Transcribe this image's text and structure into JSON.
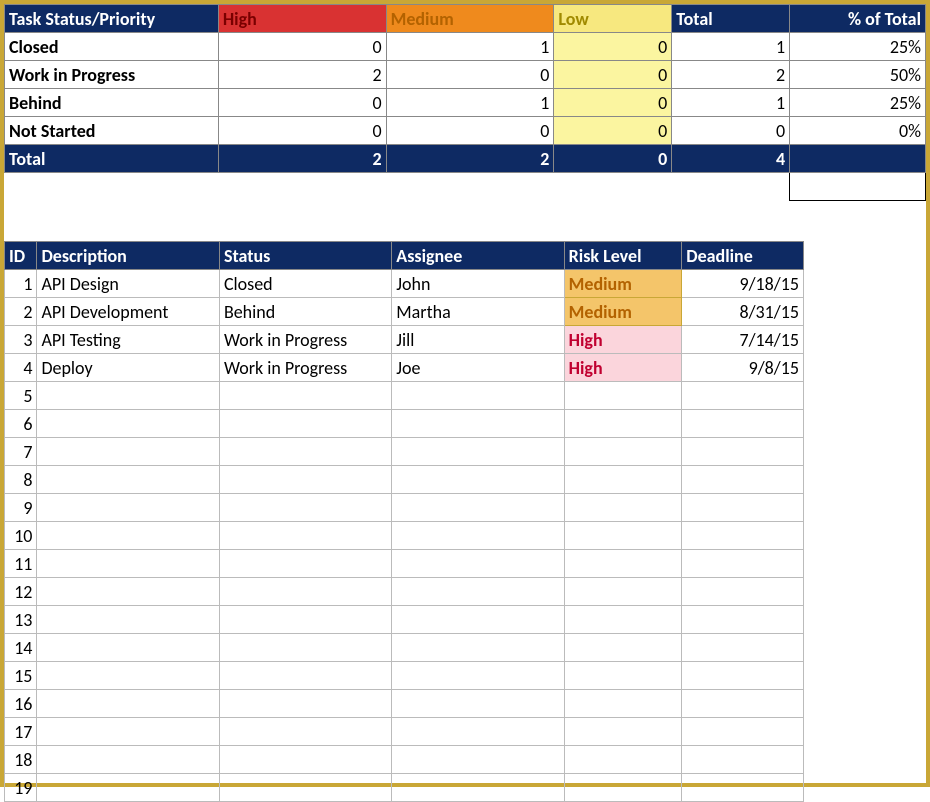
{
  "summary": {
    "header": {
      "status_priority": "Task Status/Priority",
      "high": "High",
      "medium": "Medium",
      "low": "Low",
      "total": "Total",
      "pct": "% of Total"
    },
    "rows": [
      {
        "label": "Closed",
        "high": "0",
        "medium": "1",
        "low": "0",
        "total": "1",
        "pct": "25%"
      },
      {
        "label": "Work in Progress",
        "high": "2",
        "medium": "0",
        "low": "0",
        "total": "2",
        "pct": "50%"
      },
      {
        "label": "Behind",
        "high": "0",
        "medium": "1",
        "low": "0",
        "total": "1",
        "pct": "25%"
      },
      {
        "label": "Not Started",
        "high": "0",
        "medium": "0",
        "low": "0",
        "total": "0",
        "pct": "0%"
      }
    ],
    "totals": {
      "label": "Total",
      "high": "2",
      "medium": "2",
      "low": "0",
      "total": "4",
      "pct": ""
    }
  },
  "tasks": {
    "header": {
      "id": "ID",
      "description": "Description",
      "status": "Status",
      "assignee": "Assignee",
      "risk": "Risk Level",
      "deadline": "Deadline"
    },
    "rows": [
      {
        "id": "1",
        "description": "API Design",
        "status": "Closed",
        "assignee": "John",
        "risk": "Medium",
        "risk_class": "risk-medium",
        "deadline": "9/18/15"
      },
      {
        "id": "2",
        "description": "API Development",
        "status": "Behind",
        "assignee": "Martha",
        "risk": "Medium",
        "risk_class": "risk-medium",
        "deadline": "8/31/15"
      },
      {
        "id": "3",
        "description": "API Testing",
        "status": "Work in Progress",
        "assignee": "Jill",
        "risk": "High",
        "risk_class": "risk-high",
        "deadline": "7/14/15"
      },
      {
        "id": "4",
        "description": "Deploy",
        "status": "Work in Progress",
        "assignee": "Joe",
        "risk": "High",
        "risk_class": "risk-high",
        "deadline": "9/8/15"
      }
    ],
    "empty_start": 5,
    "empty_end": 19
  }
}
